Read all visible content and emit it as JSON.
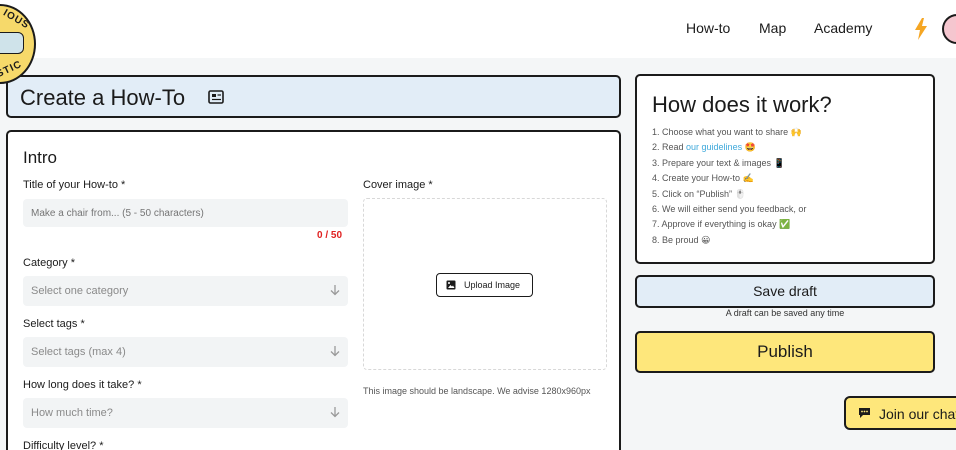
{
  "header": {
    "logo_text_top": "IOUS",
    "logo_text_bottom": "STIC",
    "nav": [
      {
        "label": "How-to"
      },
      {
        "label": "Map"
      },
      {
        "label": "Academy"
      }
    ],
    "bolt_icon": "lightning-bolt-icon",
    "avatar_icon": "user-avatar-icon"
  },
  "page": {
    "title": "Create a How-To",
    "title_icon": "how-to-book-icon"
  },
  "intro": {
    "heading": "Intro",
    "title_label": "Title of your How-to *",
    "title_placeholder": "Make a chair from... (5 - 50 characters)",
    "title_counter": "0 / 50",
    "category_label": "Category *",
    "category_placeholder": "Select one category",
    "tags_label": "Select tags *",
    "tags_placeholder": "Select tags (max 4)",
    "time_label": "How long does it take? *",
    "time_placeholder": "How much time?",
    "difficulty_label": "Difficulty level? *",
    "cover_label": "Cover image *",
    "upload_label": "Upload Image",
    "cover_note": "This image should be landscape. We advise 1280x960px"
  },
  "how_it_works": {
    "title": "How does it work?",
    "steps": [
      {
        "pre": "1. Choose what you want to share 🙌",
        "link": "",
        "post": ""
      },
      {
        "pre": "2. Read ",
        "link": "our guidelines",
        "post": " 🤩"
      },
      {
        "pre": "3. Prepare your text & images 📱",
        "link": "",
        "post": ""
      },
      {
        "pre": "4. Create your How-to ✍️",
        "link": "",
        "post": ""
      },
      {
        "pre": "5. Click on “Publish” 🖱️",
        "link": "",
        "post": ""
      },
      {
        "pre": "6. We will either send you feedback, or",
        "link": "",
        "post": ""
      },
      {
        "pre": "7. Approve if everything is okay ✅",
        "link": "",
        "post": ""
      },
      {
        "pre": "8. Be proud 😀",
        "link": "",
        "post": ""
      }
    ]
  },
  "actions": {
    "save_label": "Save draft",
    "save_note": "A draft can be saved any time",
    "publish_label": "Publish",
    "chat_label": "Join our chat"
  },
  "colors": {
    "accent_yellow": "#fee77b",
    "accent_blue": "#e2edf7",
    "link": "#3fa9db",
    "counter_red": "#e02020"
  }
}
